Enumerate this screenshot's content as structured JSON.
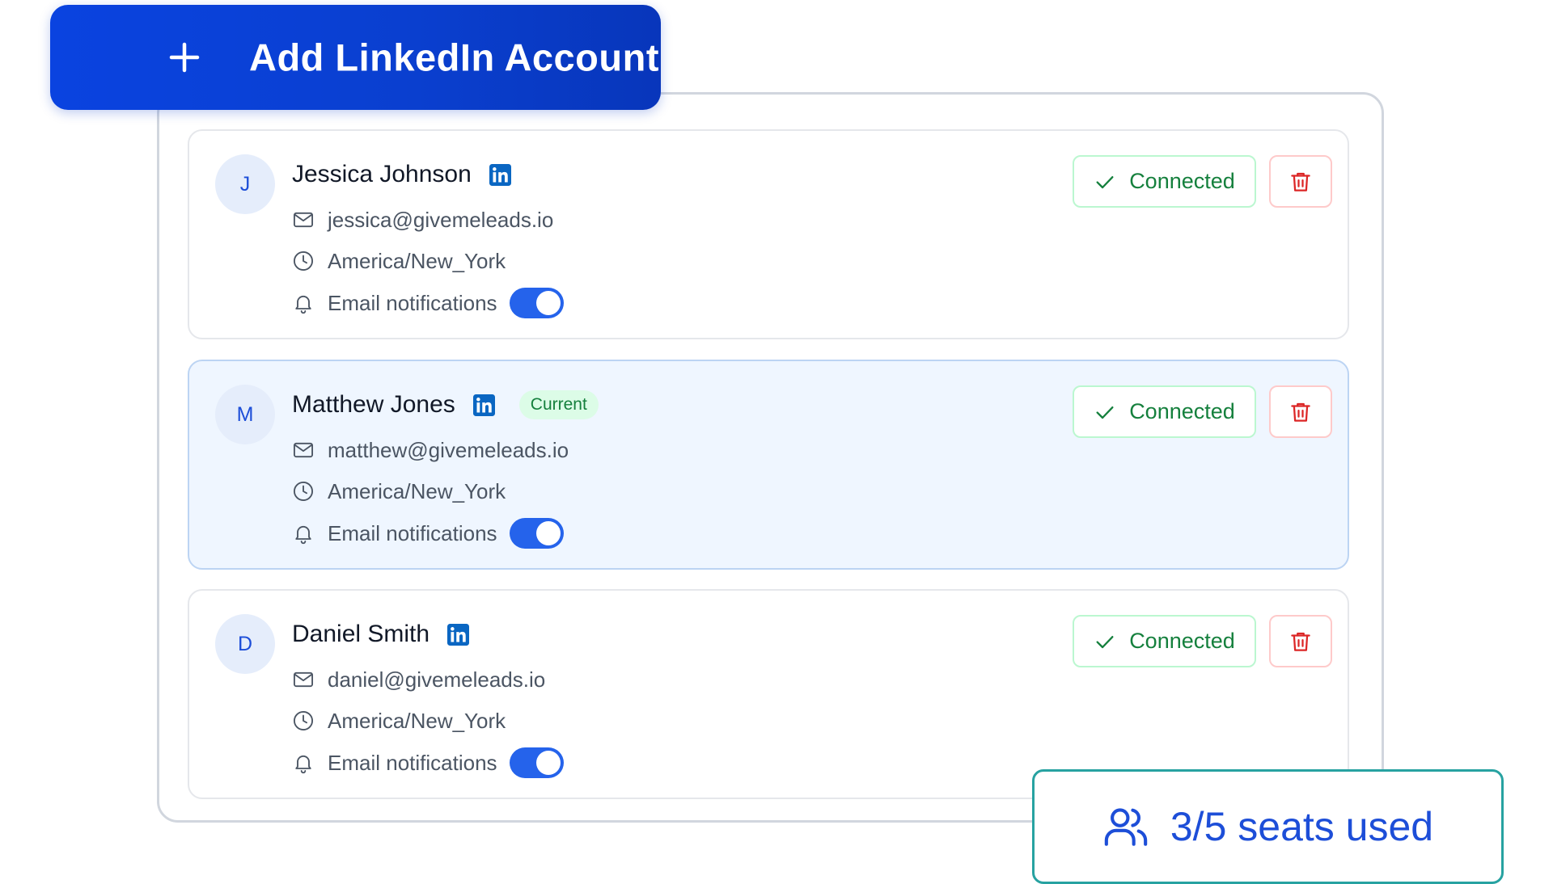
{
  "add_button": {
    "label": "Add LinkedIn Account",
    "icon": "plus-icon"
  },
  "accounts": [
    {
      "initial": "J",
      "name": "Jessica Johnson",
      "badge": "",
      "email": "jessica@givemeleads.io",
      "timezone": "America/New_York",
      "notifications_label": "Email notifications",
      "notifications_on": true,
      "status": "Connected",
      "is_current": false
    },
    {
      "initial": "M",
      "name": "Matthew Jones",
      "badge": "Current",
      "email": "matthew@givemeleads.io",
      "timezone": "America/New_York",
      "notifications_label": "Email notifications",
      "notifications_on": true,
      "status": "Connected",
      "is_current": true
    },
    {
      "initial": "D",
      "name": "Daniel Smith",
      "badge": "",
      "email": "daniel@givemeleads.io",
      "timezone": "America/New_York",
      "notifications_label": "Email notifications",
      "notifications_on": true,
      "status": "Connected",
      "is_current": false
    }
  ],
  "seats": {
    "label": "3/5 seats used",
    "used": 3,
    "total": 5,
    "icon": "users-icon"
  },
  "colors": {
    "primary": "#0a43e0",
    "linkedin": "#0a66c2",
    "connected": "#15803d",
    "delete": "#dc2626",
    "toggle_on": "#2563eb",
    "current_bg": "#eff6ff"
  }
}
